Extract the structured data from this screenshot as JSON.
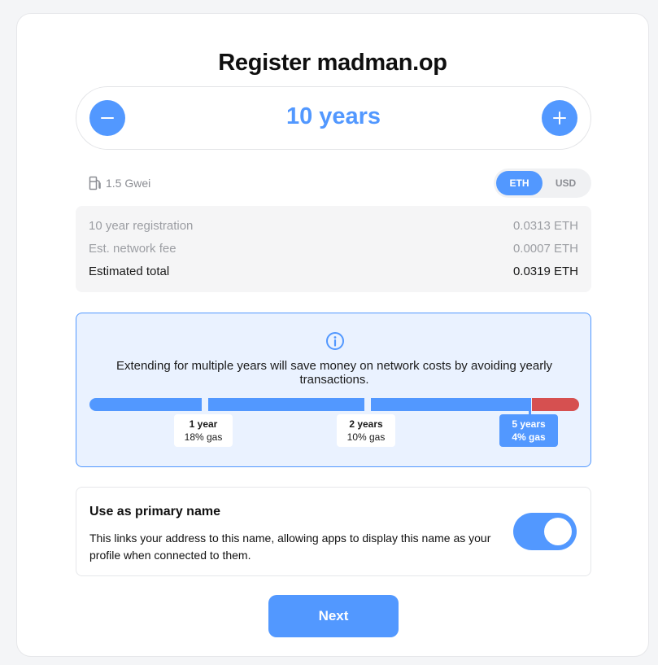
{
  "title": "Register madman.op",
  "stepper": {
    "value": "10 years",
    "minus_icon": "minus-icon",
    "plus_icon": "plus-icon"
  },
  "gas": {
    "icon": "gas-pump-icon",
    "label": "1.5 Gwei"
  },
  "currency": {
    "options": [
      "ETH",
      "USD"
    ],
    "selected": "ETH"
  },
  "invoice": {
    "rows": [
      {
        "label": "10 year registration",
        "value": "0.0313 ETH"
      },
      {
        "label": "Est. network fee",
        "value": "0.0007 ETH"
      },
      {
        "label": "Estimated total",
        "value": "0.0319 ETH"
      }
    ]
  },
  "info": {
    "icon": "info-icon",
    "text": "Extending for multiple years will save money on network costs by avoiding yearly transactions.",
    "markers": [
      {
        "years": "1 year",
        "gas": "18% gas"
      },
      {
        "years": "2 years",
        "gas": "10% gas"
      },
      {
        "years": "5 years",
        "gas": "4% gas"
      }
    ]
  },
  "primary": {
    "title": "Use as primary name",
    "description": "This links your address to this name, allowing apps to display this name as your profile when connected to them.",
    "enabled": true
  },
  "next_label": "Next",
  "colors": {
    "accent": "#5298ff",
    "warning": "#d65050",
    "info_bg": "#eaf2ff"
  }
}
